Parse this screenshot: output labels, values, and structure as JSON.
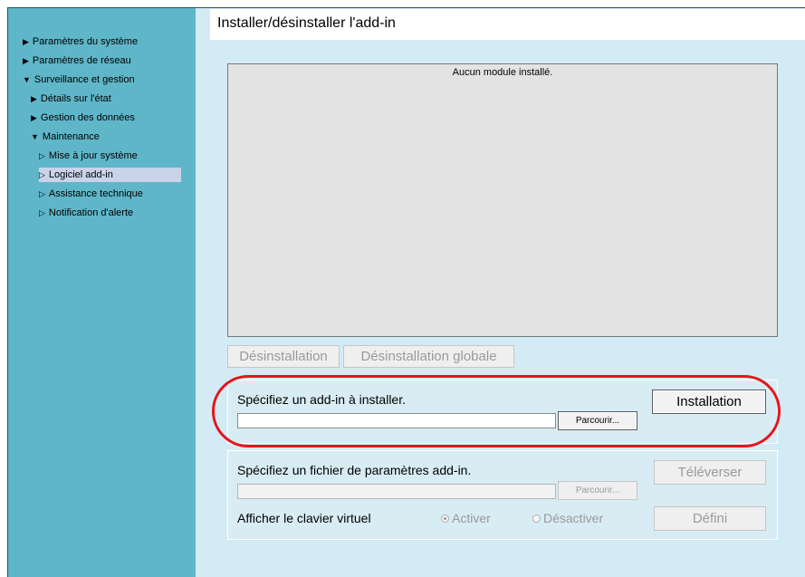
{
  "sidebar": {
    "items": [
      {
        "label": "Paramètres du système"
      },
      {
        "label": "Paramètres de réseau"
      },
      {
        "label": "Surveillance et gestion"
      },
      {
        "label": "Détails sur l'état"
      },
      {
        "label": "Gestion des données"
      },
      {
        "label": "Maintenance"
      },
      {
        "label": "Mise à jour système"
      },
      {
        "label": "Logiciel add-in"
      },
      {
        "label": "Assistance technique"
      },
      {
        "label": "Notification d'alerte"
      }
    ],
    "selected": "Logiciel add-in"
  },
  "page": {
    "title": "Installer/désinstaller l'add-in"
  },
  "module_list": {
    "empty_message": "Aucun module installé."
  },
  "list_buttons": {
    "uninstall": "Désinstallation",
    "uninstall_all": "Désinstallation globale"
  },
  "install_section": {
    "prompt": "Spécifiez un add-in à installer.",
    "file_value": "",
    "browse_label": "Parcourir...",
    "install_button": "Installation"
  },
  "params_section": {
    "prompt": "Spécifiez un fichier de paramètres add-in.",
    "file_value": "",
    "browse_label": "Parcourir...",
    "upload_button": "Téléverser",
    "keyboard_label": "Afficher le clavier virtuel",
    "options": [
      {
        "label": "Activer",
        "selected": true
      },
      {
        "label": "Désactiver",
        "selected": false
      }
    ],
    "set_button": "Défini"
  },
  "colors": {
    "sidebar_bg": "#5fb6c9",
    "content_bg": "#d3ebf5",
    "highlight": "#e8141b",
    "selected_item": "#c9d3ea"
  }
}
